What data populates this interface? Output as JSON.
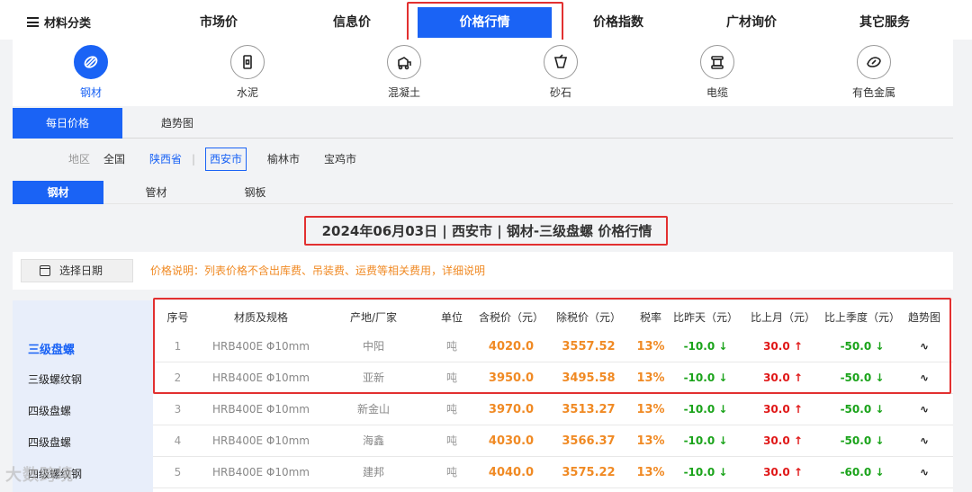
{
  "nav": {
    "menu_label": "材料分类",
    "items": [
      "市场价",
      "信息价",
      "价格行情",
      "价格指数",
      "广材询价",
      "其它服务"
    ],
    "active_index": 2
  },
  "categories": [
    {
      "label": "钢材",
      "icon": "steel-icon"
    },
    {
      "label": "水泥",
      "icon": "cement-icon"
    },
    {
      "label": "混凝土",
      "icon": "concrete-mixer-icon"
    },
    {
      "label": "砂石",
      "icon": "sand-gravel-icon"
    },
    {
      "label": "电缆",
      "icon": "cable-icon"
    },
    {
      "label": "有色金属",
      "icon": "nonferrous-metal-icon"
    }
  ],
  "tabs": [
    "每日价格",
    "趋势图"
  ],
  "region": {
    "label": "地区",
    "national": "全国",
    "separator": "|",
    "province": "陕西省",
    "cities": [
      "西安市",
      "榆林市",
      "宝鸡市"
    ]
  },
  "subtabs": [
    "钢材",
    "管材",
    "钢板"
  ],
  "heading": "2024年06月03日 | 西安市 | 钢材-三级盘螺 价格行情",
  "date_button": "选择日期",
  "price_note": "价格说明：列表价格不含出库费、吊装费、运费等相关费用，详细说明",
  "left_list": [
    "三级盘螺",
    "三级螺纹钢",
    "四级盘螺",
    "四级盘螺",
    "四级螺纹钢"
  ],
  "table": {
    "headers": [
      "序号",
      "材质及规格",
      "产地/厂家",
      "单位",
      "含税价（元）",
      "除税价（元）",
      "税率",
      "比昨天（元）",
      "比上月（元）",
      "比上季度（元）",
      "趋势图"
    ],
    "rows": [
      {
        "no": "1",
        "spec": "HRB400E Φ10mm",
        "origin": "中阳",
        "unit": "吨",
        "tax_price": "4020.0",
        "net_price": "3557.52",
        "rate": "13%",
        "vs_day": "-10.0 ↓",
        "vs_month": "30.0 ↑",
        "vs_quarter": "-50.0 ↓",
        "trend": "∿"
      },
      {
        "no": "2",
        "spec": "HRB400E Φ10mm",
        "origin": "亚新",
        "unit": "吨",
        "tax_price": "3950.0",
        "net_price": "3495.58",
        "rate": "13%",
        "vs_day": "-10.0 ↓",
        "vs_month": "30.0 ↑",
        "vs_quarter": "-50.0 ↓",
        "trend": "∿"
      },
      {
        "no": "3",
        "spec": "HRB400E Φ10mm",
        "origin": "新金山",
        "unit": "吨",
        "tax_price": "3970.0",
        "net_price": "3513.27",
        "rate": "13%",
        "vs_day": "-10.0 ↓",
        "vs_month": "30.0 ↑",
        "vs_quarter": "-50.0 ↓",
        "trend": "∿"
      },
      {
        "no": "4",
        "spec": "HRB400E Φ10mm",
        "origin": "海鑫",
        "unit": "吨",
        "tax_price": "4030.0",
        "net_price": "3566.37",
        "rate": "13%",
        "vs_day": "-10.0 ↓",
        "vs_month": "30.0 ↑",
        "vs_quarter": "-50.0 ↓",
        "trend": "∿"
      },
      {
        "no": "5",
        "spec": "HRB400E Φ10mm",
        "origin": "建邦",
        "unit": "吨",
        "tax_price": "4040.0",
        "net_price": "3575.22",
        "rate": "13%",
        "vs_day": "-10.0 ↓",
        "vs_month": "30.0 ↑",
        "vs_quarter": "-60.0 ↓",
        "trend": "∿"
      }
    ]
  },
  "watermark": "大数跨境",
  "colors": {
    "accent": "#1a63f5",
    "price": "#f08a24",
    "down": "#1aa31a",
    "up": "#e01818",
    "highlight": "#e23030"
  }
}
